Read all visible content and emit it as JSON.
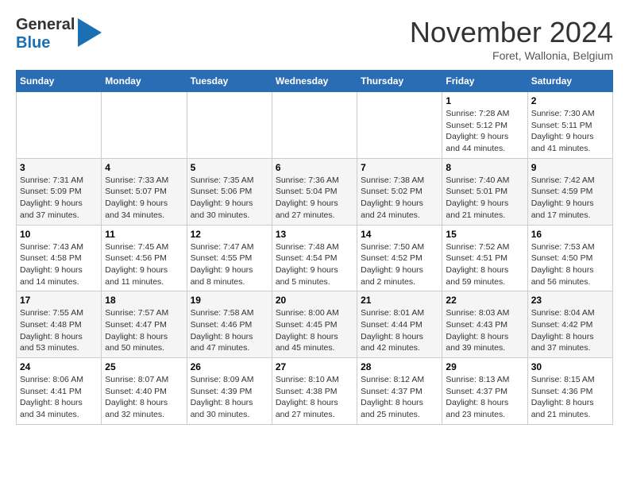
{
  "header": {
    "logo_line1": "General",
    "logo_line2": "Blue",
    "month": "November 2024",
    "location": "Foret, Wallonia, Belgium"
  },
  "weekdays": [
    "Sunday",
    "Monday",
    "Tuesday",
    "Wednesday",
    "Thursday",
    "Friday",
    "Saturday"
  ],
  "weeks": [
    [
      {
        "day": "",
        "detail": ""
      },
      {
        "day": "",
        "detail": ""
      },
      {
        "day": "",
        "detail": ""
      },
      {
        "day": "",
        "detail": ""
      },
      {
        "day": "",
        "detail": ""
      },
      {
        "day": "1",
        "detail": "Sunrise: 7:28 AM\nSunset: 5:12 PM\nDaylight: 9 hours and 44 minutes."
      },
      {
        "day": "2",
        "detail": "Sunrise: 7:30 AM\nSunset: 5:11 PM\nDaylight: 9 hours and 41 minutes."
      }
    ],
    [
      {
        "day": "3",
        "detail": "Sunrise: 7:31 AM\nSunset: 5:09 PM\nDaylight: 9 hours and 37 minutes."
      },
      {
        "day": "4",
        "detail": "Sunrise: 7:33 AM\nSunset: 5:07 PM\nDaylight: 9 hours and 34 minutes."
      },
      {
        "day": "5",
        "detail": "Sunrise: 7:35 AM\nSunset: 5:06 PM\nDaylight: 9 hours and 30 minutes."
      },
      {
        "day": "6",
        "detail": "Sunrise: 7:36 AM\nSunset: 5:04 PM\nDaylight: 9 hours and 27 minutes."
      },
      {
        "day": "7",
        "detail": "Sunrise: 7:38 AM\nSunset: 5:02 PM\nDaylight: 9 hours and 24 minutes."
      },
      {
        "day": "8",
        "detail": "Sunrise: 7:40 AM\nSunset: 5:01 PM\nDaylight: 9 hours and 21 minutes."
      },
      {
        "day": "9",
        "detail": "Sunrise: 7:42 AM\nSunset: 4:59 PM\nDaylight: 9 hours and 17 minutes."
      }
    ],
    [
      {
        "day": "10",
        "detail": "Sunrise: 7:43 AM\nSunset: 4:58 PM\nDaylight: 9 hours and 14 minutes."
      },
      {
        "day": "11",
        "detail": "Sunrise: 7:45 AM\nSunset: 4:56 PM\nDaylight: 9 hours and 11 minutes."
      },
      {
        "day": "12",
        "detail": "Sunrise: 7:47 AM\nSunset: 4:55 PM\nDaylight: 9 hours and 8 minutes."
      },
      {
        "day": "13",
        "detail": "Sunrise: 7:48 AM\nSunset: 4:54 PM\nDaylight: 9 hours and 5 minutes."
      },
      {
        "day": "14",
        "detail": "Sunrise: 7:50 AM\nSunset: 4:52 PM\nDaylight: 9 hours and 2 minutes."
      },
      {
        "day": "15",
        "detail": "Sunrise: 7:52 AM\nSunset: 4:51 PM\nDaylight: 8 hours and 59 minutes."
      },
      {
        "day": "16",
        "detail": "Sunrise: 7:53 AM\nSunset: 4:50 PM\nDaylight: 8 hours and 56 minutes."
      }
    ],
    [
      {
        "day": "17",
        "detail": "Sunrise: 7:55 AM\nSunset: 4:48 PM\nDaylight: 8 hours and 53 minutes."
      },
      {
        "day": "18",
        "detail": "Sunrise: 7:57 AM\nSunset: 4:47 PM\nDaylight: 8 hours and 50 minutes."
      },
      {
        "day": "19",
        "detail": "Sunrise: 7:58 AM\nSunset: 4:46 PM\nDaylight: 8 hours and 47 minutes."
      },
      {
        "day": "20",
        "detail": "Sunrise: 8:00 AM\nSunset: 4:45 PM\nDaylight: 8 hours and 45 minutes."
      },
      {
        "day": "21",
        "detail": "Sunrise: 8:01 AM\nSunset: 4:44 PM\nDaylight: 8 hours and 42 minutes."
      },
      {
        "day": "22",
        "detail": "Sunrise: 8:03 AM\nSunset: 4:43 PM\nDaylight: 8 hours and 39 minutes."
      },
      {
        "day": "23",
        "detail": "Sunrise: 8:04 AM\nSunset: 4:42 PM\nDaylight: 8 hours and 37 minutes."
      }
    ],
    [
      {
        "day": "24",
        "detail": "Sunrise: 8:06 AM\nSunset: 4:41 PM\nDaylight: 8 hours and 34 minutes."
      },
      {
        "day": "25",
        "detail": "Sunrise: 8:07 AM\nSunset: 4:40 PM\nDaylight: 8 hours and 32 minutes."
      },
      {
        "day": "26",
        "detail": "Sunrise: 8:09 AM\nSunset: 4:39 PM\nDaylight: 8 hours and 30 minutes."
      },
      {
        "day": "27",
        "detail": "Sunrise: 8:10 AM\nSunset: 4:38 PM\nDaylight: 8 hours and 27 minutes."
      },
      {
        "day": "28",
        "detail": "Sunrise: 8:12 AM\nSunset: 4:37 PM\nDaylight: 8 hours and 25 minutes."
      },
      {
        "day": "29",
        "detail": "Sunrise: 8:13 AM\nSunset: 4:37 PM\nDaylight: 8 hours and 23 minutes."
      },
      {
        "day": "30",
        "detail": "Sunrise: 8:15 AM\nSunset: 4:36 PM\nDaylight: 8 hours and 21 minutes."
      }
    ]
  ]
}
